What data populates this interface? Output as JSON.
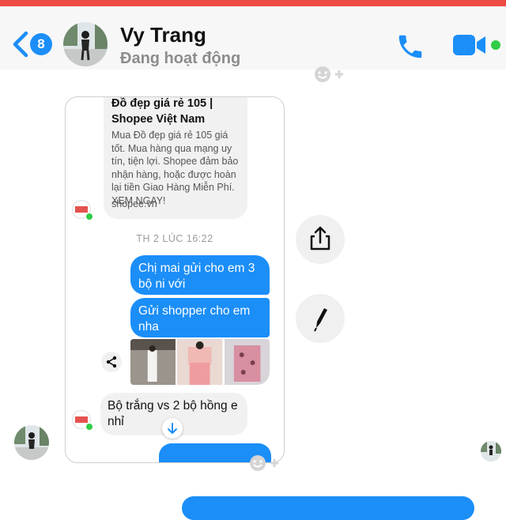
{
  "header": {
    "back_count": "8",
    "contact_name": "Vy Trang",
    "status": "Đang hoạt động",
    "accent": "#1b8ef8",
    "online_color": "#31cc46",
    "top_strip_color": "#ef4b45"
  },
  "screenshot": {
    "link_preview": {
      "title": "Đồ đẹp giá rẻ 105 | Shopee Việt Nam",
      "description": "Mua Đồ đẹp giá rẻ 105 giá tốt. Mua hàng qua mạng uy tín, tiện lợi. Shopee đảm bảo nhận hàng, hoặc được hoàn lại tiền Giao Hàng Miễn Phí. XEM NGAY!",
      "domain": "shopee.vn"
    },
    "timestamp": "TH 2 LÚC 16:22",
    "messages_out": [
      "Chị mai gửi cho em 3 bộ ni với",
      "Gửi shopper cho em nha"
    ],
    "message_in": "Bộ trắng vs 2 bộ hồng e nhỉ"
  },
  "icons": {
    "back": "chevron-left-icon",
    "call": "phone-icon",
    "video": "video-camera-icon",
    "reaction": "smiley-plus-icon",
    "share": "share-icon",
    "edit": "pencil-icon"
  }
}
